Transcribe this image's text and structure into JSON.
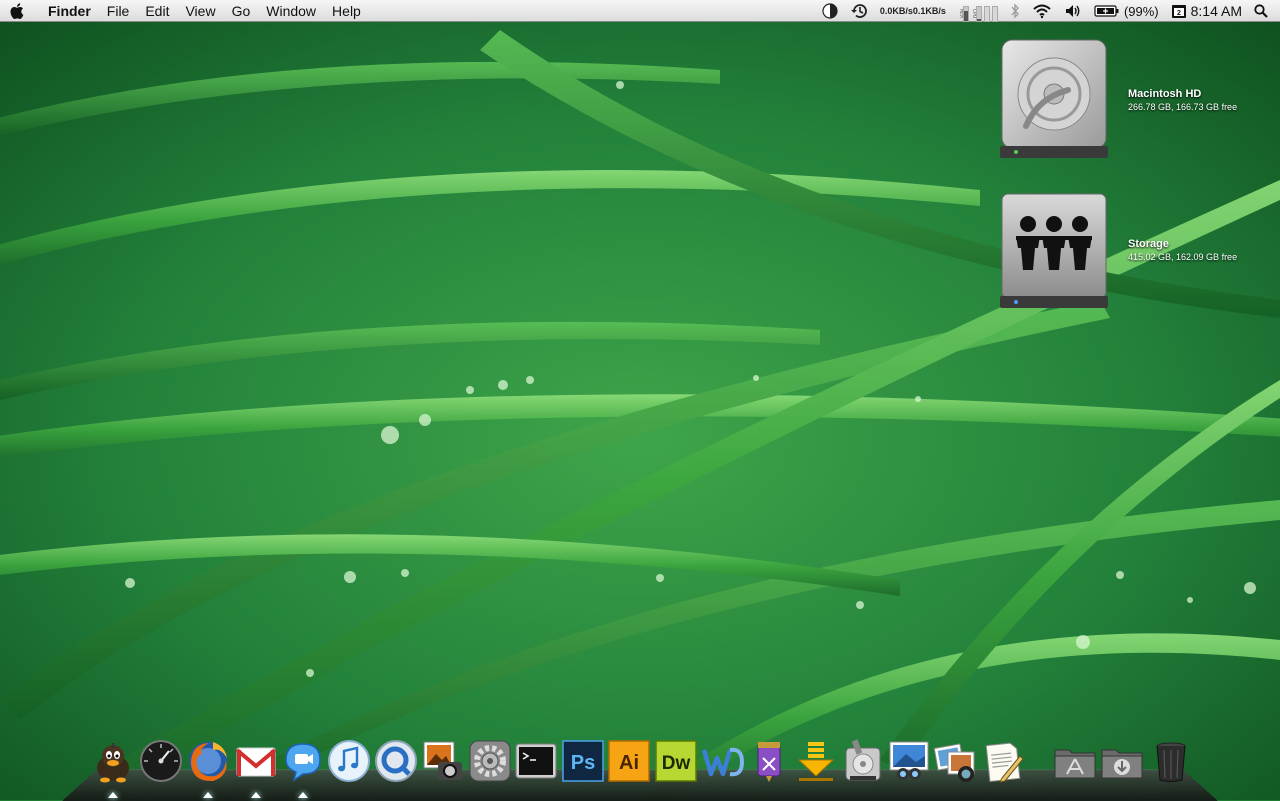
{
  "menubar": {
    "app_name": "Finder",
    "menus": [
      "File",
      "Edit",
      "View",
      "Go",
      "Window",
      "Help"
    ],
    "status": {
      "network_up": "0.0KB/s",
      "network_down": "0.1KB/s",
      "meter_labels": [
        "MEM",
        "CPU"
      ],
      "battery_percent": "(99%)",
      "calendar_day": "2",
      "clock": "8:14 AM"
    }
  },
  "desktop_icons": [
    {
      "name": "Macintosh HD",
      "info": "266.78 GB, 166.73 GB free",
      "icon": "hard-drive-icon"
    },
    {
      "name": "Storage",
      "info": "415.02 GB, 162.09 GB free",
      "icon": "shared-drive-icon"
    }
  ],
  "dock": {
    "items": [
      {
        "id": "adium",
        "icon": "duck-icon",
        "running": true
      },
      {
        "id": "dashboard",
        "icon": "dashboard-icon",
        "running": false
      },
      {
        "id": "firefox",
        "icon": "firefox-icon",
        "running": true
      },
      {
        "id": "gmail",
        "icon": "gmail-icon",
        "running": true
      },
      {
        "id": "ichat",
        "icon": "ichat-icon",
        "running": true
      },
      {
        "id": "itunes",
        "icon": "itunes-icon",
        "running": false
      },
      {
        "id": "quicktime",
        "icon": "quicktime-icon",
        "running": false
      },
      {
        "id": "image-capture",
        "icon": "image-capture-icon",
        "running": false
      },
      {
        "id": "system-preferences",
        "icon": "system-preferences-icon",
        "running": false
      },
      {
        "id": "terminal",
        "icon": "terminal-icon",
        "running": false
      },
      {
        "id": "photoshop",
        "icon": "photoshop-icon",
        "label": "Ps",
        "running": false
      },
      {
        "id": "illustrator",
        "icon": "illustrator-icon",
        "label": "Ai",
        "running": false
      },
      {
        "id": "dreamweaver",
        "icon": "dreamweaver-icon",
        "label": "Dw",
        "running": false
      },
      {
        "id": "word",
        "icon": "word-icon",
        "running": false
      },
      {
        "id": "app-pencil",
        "icon": "pencil-app-icon",
        "running": false
      },
      {
        "id": "downloads-app",
        "icon": "download-arrow-icon",
        "running": false
      },
      {
        "id": "disk-utility",
        "icon": "disk-utility-icon",
        "running": false
      },
      {
        "id": "preview",
        "icon": "preview-icon",
        "running": false
      },
      {
        "id": "iphoto",
        "icon": "iphoto-icon",
        "running": false
      },
      {
        "id": "textedit",
        "icon": "textedit-icon",
        "running": false
      },
      {
        "id": "applications-folder",
        "icon": "applications-folder-icon",
        "running": false
      },
      {
        "id": "downloads-folder",
        "icon": "downloads-folder-icon",
        "running": false
      },
      {
        "id": "trash",
        "icon": "trash-icon",
        "running": false
      }
    ]
  },
  "colors": {
    "grass_dark": "#0f4a1c",
    "grass_mid": "#2e8b3e",
    "grass_light": "#6fcf5a"
  }
}
